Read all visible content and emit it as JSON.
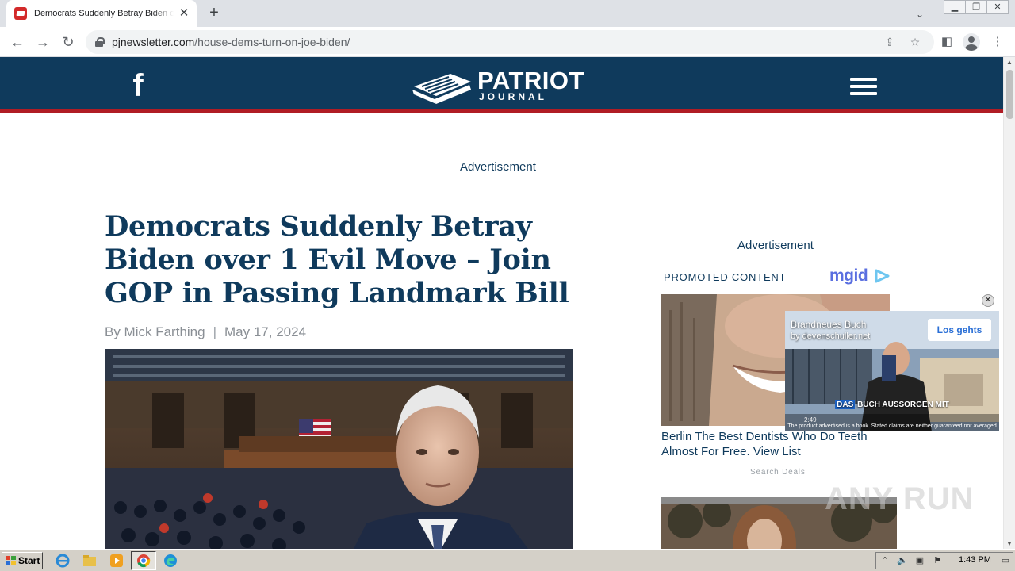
{
  "browser": {
    "tab_title": "Democrats Suddenly Betray Biden over 1 Evil Move – Join GOP in Passing Landmark Bill",
    "tab_close": "✕",
    "new_tab": "+",
    "url_domain": "pjnewsletter.com",
    "url_path": "/house-dems-turn-on-joe-biden/"
  },
  "site": {
    "logo_word": "PATRIOT",
    "logo_sub": "JOURNAL",
    "colors": {
      "header_bg": "#0f3a5c",
      "header_stripe": "#b01c24",
      "headline": "#0f3a5c"
    }
  },
  "page": {
    "ad_label_top": "Advertisement",
    "headline": "Democrats Suddenly Betray Biden over 1 Evil Move – Join GOP in Passing Landmark Bill",
    "byline_author": "By Mick Farthing",
    "byline_separator": "|",
    "byline_date": "May 17, 2024"
  },
  "sidebar": {
    "ad_label": "Advertisement",
    "promo_label": "PROMOTED CONTENT",
    "mgid_logo": "mgid",
    "promo1_text": "Berlin The Best Dentists Who Do Teeth Almost For Free. View List",
    "promo1_source": "Search Deals"
  },
  "video_ad": {
    "title": "Brandneues Buch",
    "subtitle": "by devenschuller.net",
    "cta": "Los gehts",
    "caption_highlight": "DAS",
    "caption_rest": "BUCH AUSSORGEN MIT",
    "time": "2:49",
    "disclaimer": "The product advertised is a book. Stated claims are neither guaranteed nor averaged",
    "close": "✕"
  },
  "watermark": "ANY RUN",
  "taskbar": {
    "start_label": "Start",
    "clock": "1:43 PM"
  }
}
